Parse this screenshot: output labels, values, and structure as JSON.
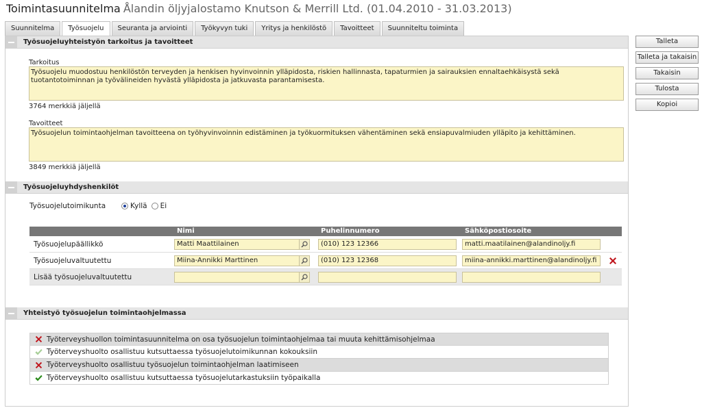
{
  "header": {
    "title_main": "Toimintasuunnitelma",
    "title_sub": "Ålandin öljyjalostamo Knutson & Merrill Ltd. (01.04.2010 - 31.03.2013)"
  },
  "tabs": [
    {
      "label": "Suunnitelma",
      "active": false
    },
    {
      "label": "Työsuojelu",
      "active": true
    },
    {
      "label": "Seuranta ja arviointi",
      "active": false
    },
    {
      "label": "Työkyvyn tuki",
      "active": false
    },
    {
      "label": "Yritys ja henkilöstö",
      "active": false
    },
    {
      "label": "Tavoitteet",
      "active": false
    },
    {
      "label": "Suunniteltu toiminta",
      "active": false
    }
  ],
  "section1": {
    "heading": "Työsuojeluyhteistyön tarkoitus ja tavoitteet",
    "purpose_label": "Tarkoitus",
    "purpose_text": "Työsuojelu muodostuu henkilöstön terveyden ja henkisen hyvinvoinnin ylläpidosta, riskien hallinnasta, tapaturmien ja sairauksien ennaltaehkäisystä sekä tuotantotoiminnan ja työvälineiden hyvästä ylläpidosta ja jatkuvasta parantamisesta.",
    "purpose_remaining": "3764 merkkiä jäljellä",
    "goals_label": "Tavoitteet",
    "goals_text": "Työsuojelun toimintaohjelman tavoitteena on työhyvinvoinnin edistäminen ja työkuormituksen vähentäminen sekä ensiapuvalmiuden ylläpito ja kehittäminen.",
    "goals_remaining": "3849 merkkiä jäljellä"
  },
  "section2": {
    "heading": "Työsuojeluyhdyshenkilöt",
    "committee_label": "Työsuojelutoimikunta",
    "radio_yes": "Kyllä",
    "radio_no": "Ei",
    "radio_selected": "Kyllä",
    "columns": [
      "Nimi",
      "Puhelinnumero",
      "Sähköpostiosoite"
    ],
    "rows": [
      {
        "role": "Työsuojelupäällikkö",
        "name": "Matti Maattilainen",
        "phone": "(010) 123 12366",
        "email": "matti.maatilainen@alandinoljy.fi"
      },
      {
        "role": "Työsuojeluvaltuutettu",
        "name": "Miina-Annikki Marttinen",
        "phone": "(010) 123 12368",
        "email": "miina-annikki.marttinen@alandinoljy.fi"
      },
      {
        "role": "Lisää työsuojeluvaltuutettu",
        "name": "",
        "phone": "",
        "email": ""
      }
    ]
  },
  "section3": {
    "heading": "Yhteistyö työsuojelun toimintaohjelmassa",
    "items": [
      {
        "text": "Työterveyshuollon toimintasuunnitelma on osa työsuojelun toimintaohjelmaa tai muuta kehittämisohjelmaa",
        "status": "no"
      },
      {
        "text": "Työterveyshuolto osallistuu kutsuttaessa työsuojelutoimikunnan kokouksiin",
        "status": "unset"
      },
      {
        "text": "Työterveyshuolto osallistuu työsuojelun toimintaohjelman laatimiseen",
        "status": "no"
      },
      {
        "text": "Työterveyshuolto osallistuu kutsuttaessa työsuojelutarkastuksiin työpaikalla",
        "status": "yes"
      }
    ]
  },
  "actions": {
    "save": "Talleta",
    "save_back": "Talleta ja takaisin",
    "back": "Takaisin",
    "print": "Tulosta",
    "copy": "Kopioi"
  },
  "colors": {
    "field_bg": "#fbf5c7",
    "header_bg": "#777777",
    "cross": "#c0161d",
    "check": "#2a8a1a",
    "check_faded": "#a8cf98"
  },
  "icons": [
    "collapse-icon",
    "search-icon",
    "delete-icon",
    "cross-icon",
    "check-icon"
  ]
}
